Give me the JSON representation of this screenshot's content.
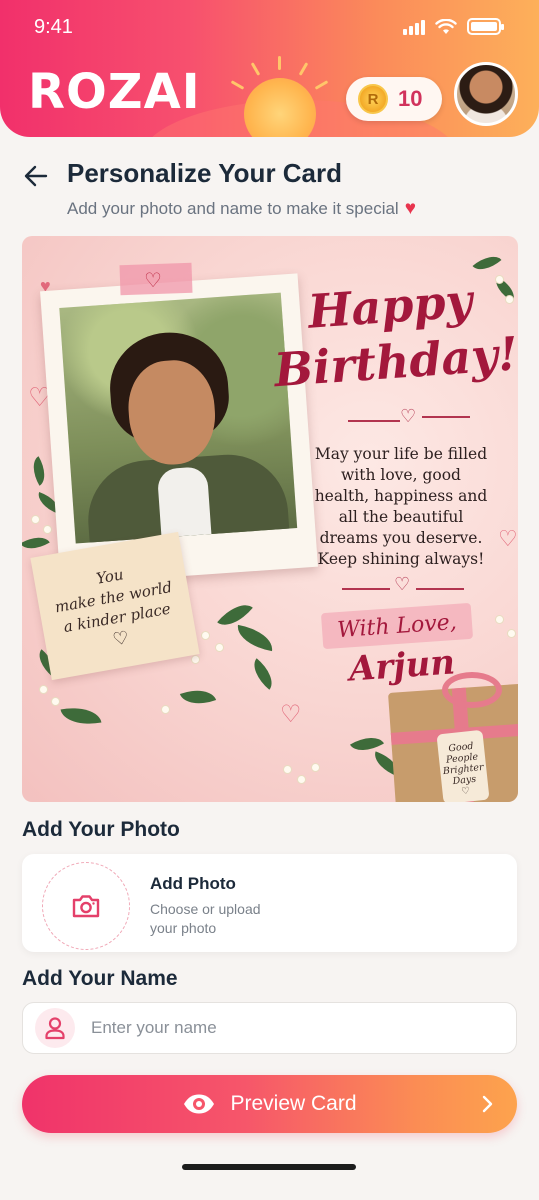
{
  "status_bar": {
    "time": "9:41"
  },
  "header": {
    "logo": "ROZAI",
    "coin_symbol": "R",
    "coin_count": "10"
  },
  "page": {
    "title": "Personalize Your Card",
    "subtitle": "Add your photo and name to make it special",
    "subtitle_icon": "heart-icon"
  },
  "card": {
    "heading_line1": "Happy",
    "heading_line2": "Birthday!",
    "message": "May your life be filled with love, good health, happiness and all the beautiful dreams you deserve. Keep shining always!",
    "note_line1": "You",
    "note_line2": "make the world",
    "note_line3": "a kinder place",
    "closing": "With Love,",
    "sender": "Arjun",
    "tag_line1": "Good",
    "tag_line2": "People",
    "tag_line3": "Brighter",
    "tag_line4": "Days"
  },
  "photo_section": {
    "label": "Add Your Photo",
    "title": "Add Photo",
    "description": "Choose or upload your photo",
    "icon": "camera-icon"
  },
  "name_section": {
    "label": "Add Your Name",
    "placeholder": "Enter your name",
    "value": "",
    "icon": "user-icon"
  },
  "preview_button": {
    "label": "Preview Card",
    "icon": "eye-icon"
  },
  "colors": {
    "accent": "#f0336a",
    "accent_end": "#fda34d",
    "card_script": "#a3183c",
    "heading": "#1c2a3a"
  }
}
